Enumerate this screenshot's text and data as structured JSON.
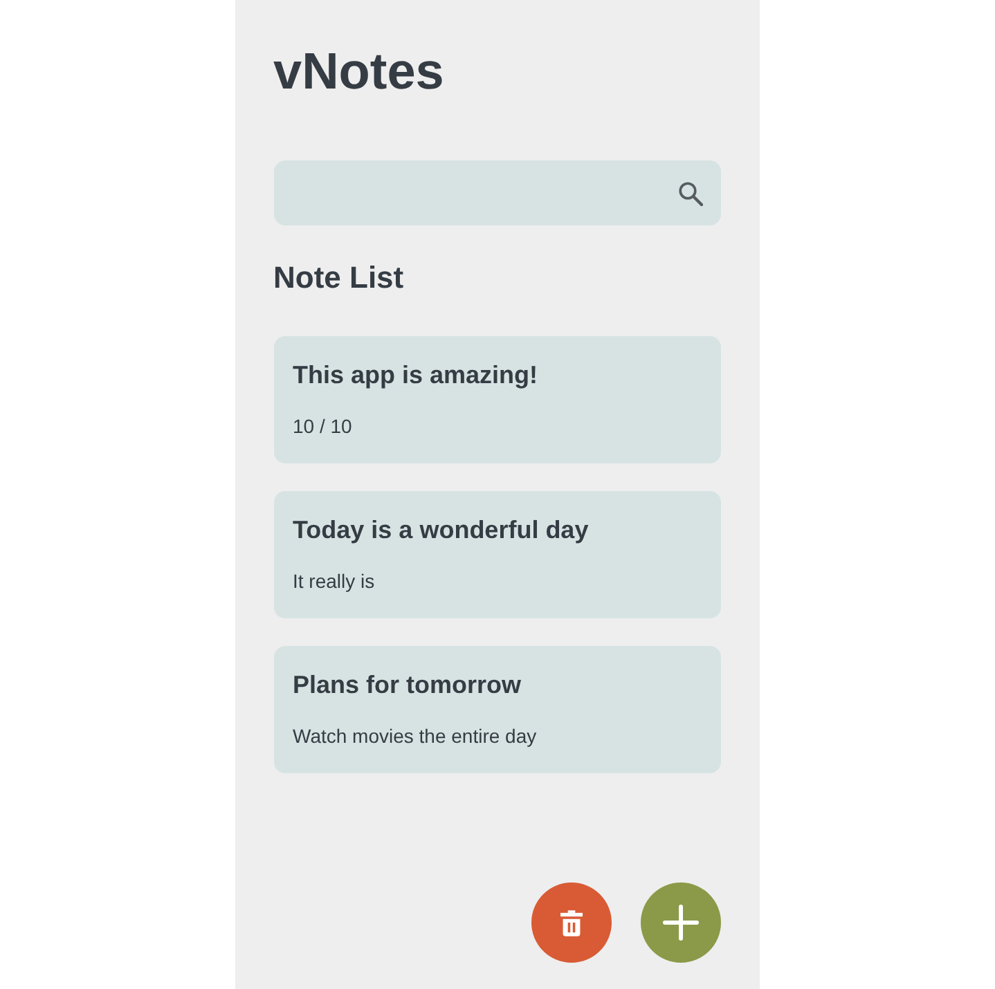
{
  "app": {
    "title": "vNotes"
  },
  "section_title": "Note List",
  "notes": [
    {
      "title": "This app is amazing!",
      "body": "10 / 10"
    },
    {
      "title": "Today is a wonderful day",
      "body": "It really is"
    },
    {
      "title": "Plans for tomorrow",
      "body": "Watch movies the entire day"
    }
  ],
  "actions": [
    {
      "kind": "delete"
    },
    {
      "kind": "add"
    }
  ]
}
